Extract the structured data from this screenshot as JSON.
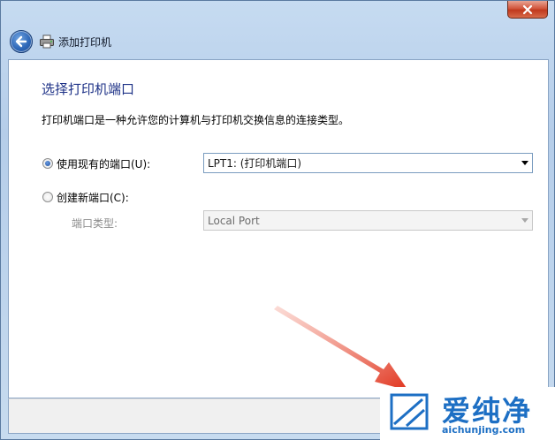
{
  "window": {
    "title": "添加打印机",
    "close_icon": "close-icon",
    "back_icon": "back-arrow-icon",
    "printer_icon": "printer-icon"
  },
  "content": {
    "heading": "选择打印机端口",
    "description": "打印机端口是一种允许您的计算机与打印机交换信息的连接类型。",
    "option_existing": {
      "label": "使用现有的端口(U):",
      "selected": true,
      "select_value": "LPT1: (打印机端口)"
    },
    "option_new": {
      "label": "创建新端口(C):",
      "selected": false,
      "port_type_label": "端口类型:",
      "select_value": "Local Port",
      "disabled": true
    }
  },
  "watermark": {
    "brand": "爱纯净",
    "url": "aichunjing.com"
  },
  "colors": {
    "heading": "#1e3287",
    "accent": "#1d6fc4",
    "annotation_arrow": "#e0331d"
  }
}
